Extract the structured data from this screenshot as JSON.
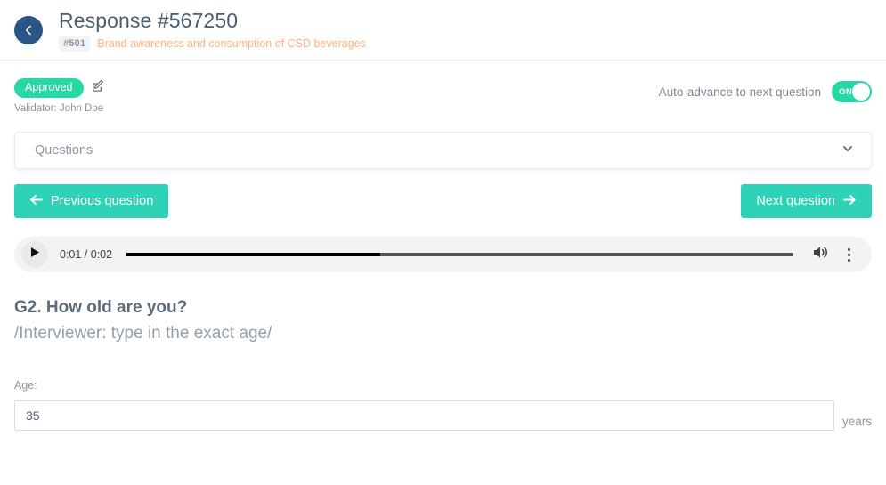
{
  "header": {
    "back_icon": "chevron-left-icon",
    "title": "Response #567250",
    "project_code": "#501",
    "project_name": "Brand awareness and consumption of CSD beverages",
    "accent_project_color": "#ffb07c",
    "back_button_color": "#2a5585"
  },
  "status": {
    "badge_label": "Approved",
    "badge_color": "#25d8a4",
    "edit_icon": "edit-pencil-icon",
    "validator_text": "Validator: John Doe",
    "auto_advance_label": "Auto-advance to next question",
    "toggle_state": "ON",
    "toggle_color": "#25d8a4"
  },
  "question_select": {
    "placeholder": "Questions",
    "chevron_icon": "chevron-down-icon"
  },
  "navigation": {
    "previous_label": "Previous question",
    "next_label": "Next question",
    "button_color": "#2ed3b7",
    "prev_icon": "arrow-left-icon",
    "next_icon": "arrow-right-icon"
  },
  "player": {
    "play_icon": "play-icon",
    "time_display": "0:01 / 0:02",
    "current_time": "0:01",
    "duration": "0:02",
    "progress_percent": 38,
    "volume_icon": "volume-high-icon",
    "menu_icon": "more-vertical-icon"
  },
  "question": {
    "title": "G2. How old are you?",
    "instruction": "/Interviewer: type in the exact age/",
    "field_label": "Age:",
    "answer_value": "35",
    "answer_placeholder": "",
    "unit": "years"
  }
}
